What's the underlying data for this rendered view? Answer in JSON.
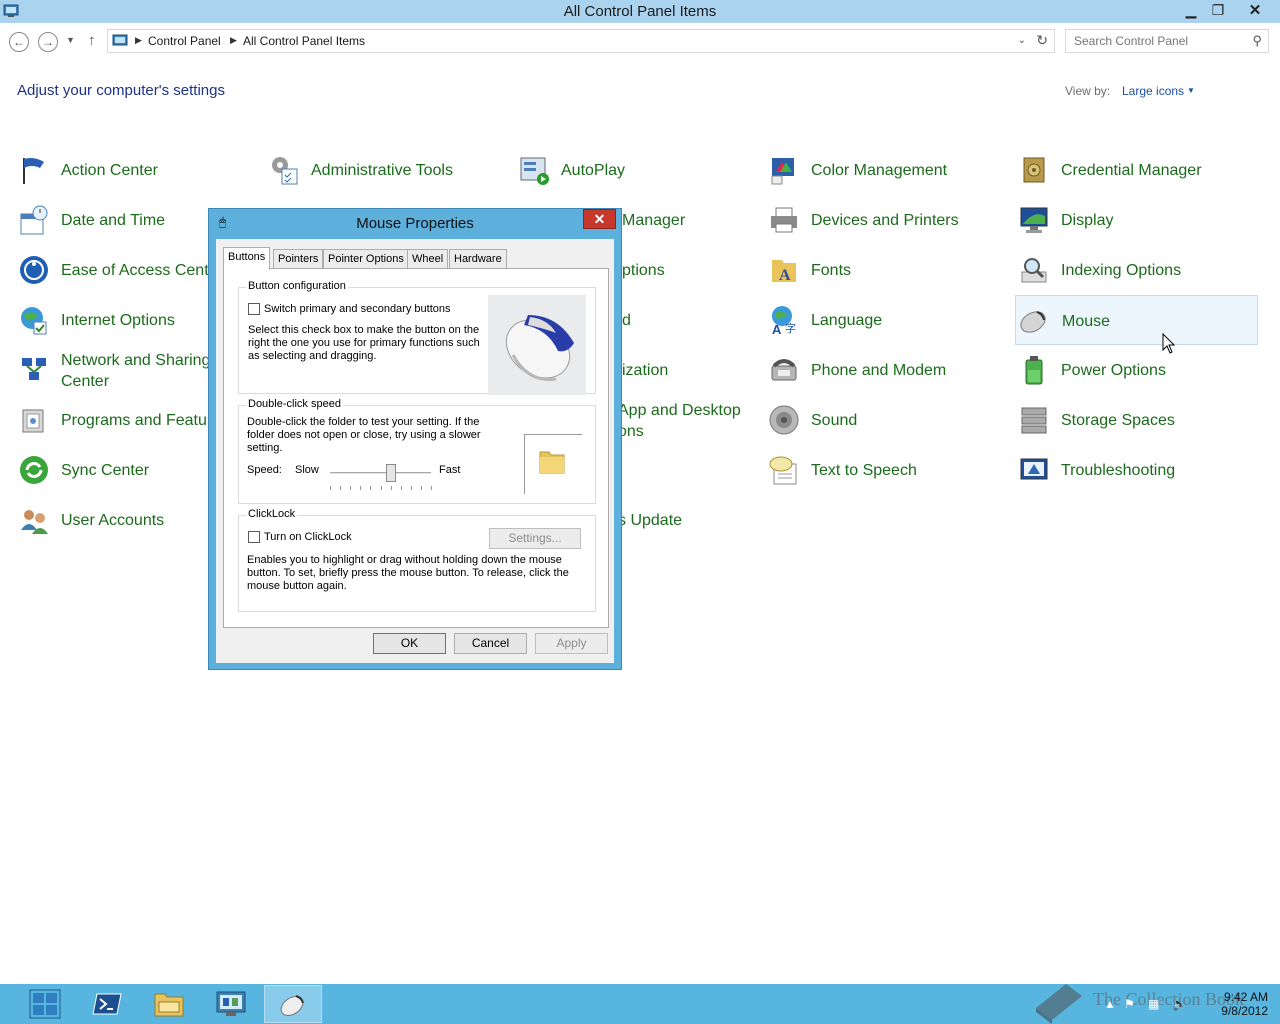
{
  "window": {
    "title": "All Control Panel Items",
    "minimize": "▁",
    "restore": "❐",
    "close": "✕"
  },
  "address": {
    "crumbs": [
      "Control Panel",
      "All Control Panel Items"
    ],
    "search_placeholder": "Search Control Panel"
  },
  "header": {
    "title": "Adjust your computer's settings",
    "view_by_label": "View by:",
    "view_by_value": "Large icons"
  },
  "items": {
    "col1": [
      "Action Center",
      "Date and Time",
      "Ease of Access Center",
      "Internet Options",
      "Network and Sharing Center",
      "Programs and Features",
      "Sync Center",
      "User Accounts"
    ],
    "col2": [
      "Administrative Tools"
    ],
    "col3": [
      "AutoPlay",
      "Manager",
      "ptions",
      "d",
      "ization",
      "App and Desktop ons",
      "s Update"
    ],
    "col4": [
      "Color Management",
      "Devices and Printers",
      "Fonts",
      "Language",
      "Phone and Modem",
      "Sound",
      "Text to Speech"
    ],
    "col5": [
      "Credential Manager",
      "Display",
      "Indexing Options",
      "Mouse",
      "Power Options",
      "Storage Spaces",
      "Troubleshooting"
    ]
  },
  "dialog": {
    "title": "Mouse Properties",
    "close": "✕",
    "tabs": [
      "Buttons",
      "Pointers",
      "Pointer Options",
      "Wheel",
      "Hardware"
    ],
    "button_config": {
      "title": "Button configuration",
      "checkbox_label": "Switch primary and secondary buttons",
      "description": "Select this check box to make the button on the right the one you use for primary functions such as selecting and dragging."
    },
    "double_click": {
      "title": "Double-click speed",
      "description": "Double-click the folder to test your setting. If the folder does not open or close, try using a slower setting.",
      "speed_label": "Speed:",
      "slow": "Slow",
      "fast": "Fast",
      "speed_value": 0.6
    },
    "clicklock": {
      "title": "ClickLock",
      "checkbox_label": "Turn on ClickLock",
      "settings_button": "Settings...",
      "description": "Enables you to highlight or drag without holding down the mouse button. To set, briefly press the mouse button. To release, click the mouse button again."
    },
    "buttons": {
      "ok": "OK",
      "cancel": "Cancel",
      "apply": "Apply"
    }
  },
  "taskbar": {
    "time": "9:42 AM",
    "date": "9/8/2012",
    "watermark": "The Collection Book"
  },
  "colors": {
    "link_green": "#1c6b1c",
    "title_blue": "#1e3287",
    "taskbar": "#57b5df",
    "titlebar": "#a9d3ef"
  }
}
